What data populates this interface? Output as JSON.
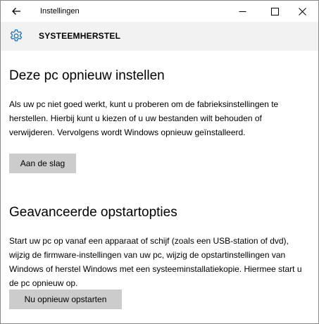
{
  "window": {
    "title": "Instellingen",
    "controls": [
      "minimize-icon",
      "maximize-icon",
      "close-icon"
    ]
  },
  "header": {
    "icon": "gear-icon",
    "title": "SYSTEEMHERSTEL"
  },
  "sections": [
    {
      "title": "Deze pc opnieuw instellen",
      "text": "Als uw pc niet goed werkt, kunt u proberen om de fabrieksinstellingen te herstellen. Hierbij kunt u kiezen of u uw bestanden wilt behouden of verwijderen. Vervolgens wordt Windows opnieuw geïnstalleerd.",
      "button": "Aan de slag"
    },
    {
      "title": "Geavanceerde opstartopties",
      "text": "Start uw pc op vanaf een apparaat of schijf (zoals een USB-station of dvd), wijzig de firmware-instellingen van uw pc, wijzig de opstartinstellingen van Windows of herstel Windows met een systeeminstallatiekopie. Hiermee start u de pc opnieuw op.",
      "button": "Nu opnieuw opstarten"
    }
  ],
  "colors": {
    "header_bg": "#f2f2f2",
    "button_bg": "#cccccc",
    "gear_icon": "#1a6fc4",
    "window_border": "#8a8a8a"
  }
}
